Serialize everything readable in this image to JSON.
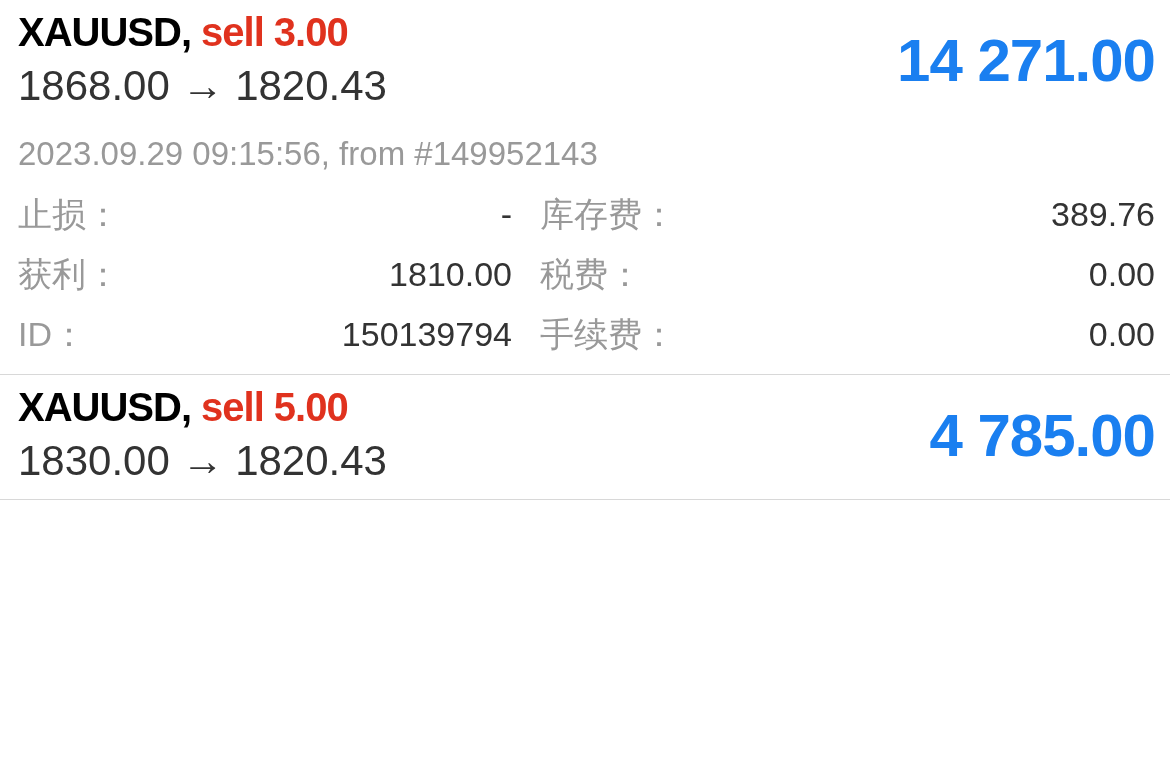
{
  "positions": [
    {
      "symbol": "XAUUSD,",
      "side": "sell 3.00",
      "prices": "1868.00 → 1820.43",
      "profit": "14 271.00",
      "opened": "2023.09.29 09:15:56, from #149952143",
      "detail_columns": [
        {
          "fields": [
            {
              "label": "止损：",
              "value": "-"
            },
            {
              "label": "获利：",
              "value": "1810.00"
            },
            {
              "label": "ID：",
              "value": "150139794"
            }
          ]
        },
        {
          "fields": [
            {
              "label": "库存费：",
              "value": "389.76"
            },
            {
              "label": "税费：",
              "value": "0.00"
            },
            {
              "label": "手续费：",
              "value": "0.00"
            }
          ]
        }
      ]
    },
    {
      "symbol": "XAUUSD,",
      "side": "sell 5.00",
      "prices": "1830.00 → 1820.43",
      "profit": "4 785.00"
    }
  ]
}
